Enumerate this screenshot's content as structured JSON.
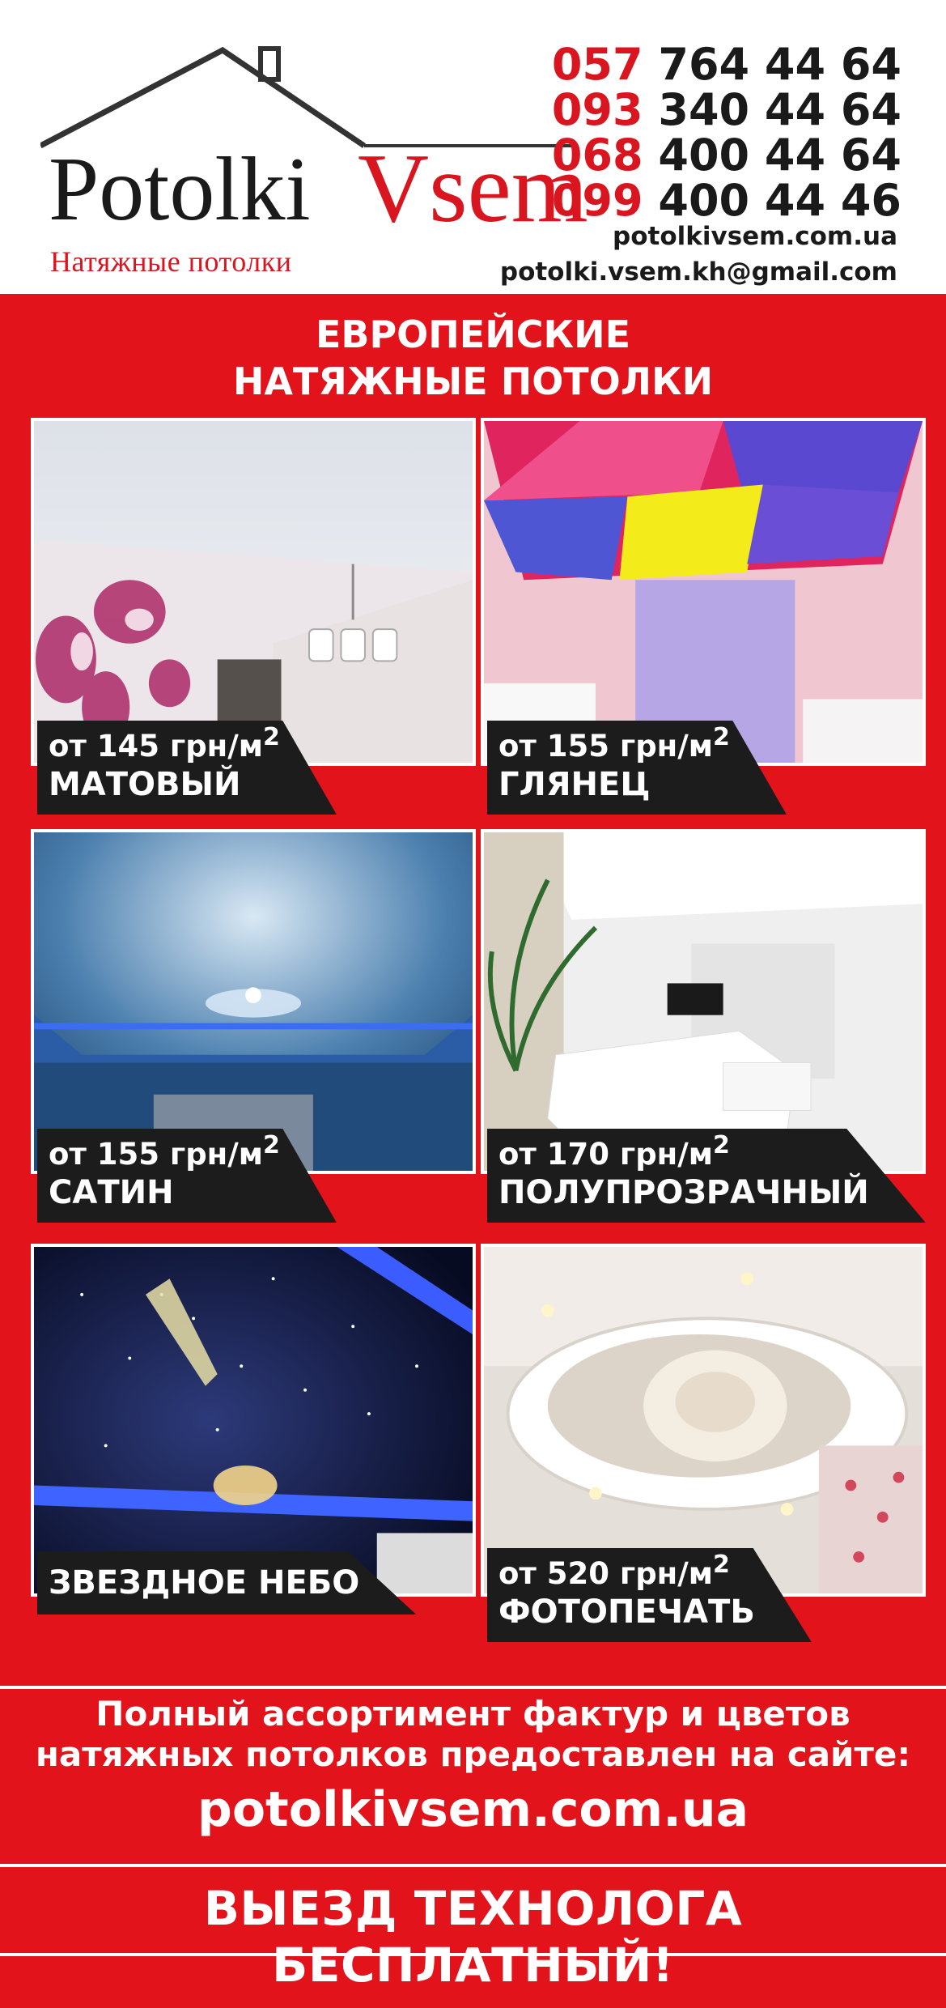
{
  "brand": {
    "name_part1": "Potolki",
    "name_part2": "Vsem",
    "subtitle": "Натяжные потолки"
  },
  "contacts": {
    "phones": [
      {
        "code": "057",
        "number": "764 44 64"
      },
      {
        "code": "093",
        "number": "340 44 64"
      },
      {
        "code": "068",
        "number": "400 44 64"
      },
      {
        "code": "099",
        "number": "400 44 46"
      }
    ],
    "website": "potolkivsem.com.ua",
    "email": "potolki.vsem.kh@gmail.com"
  },
  "headline": {
    "line1": "ЕВРОПЕЙСКИЕ",
    "line2": "НАТЯЖНЫЕ ПОТОЛКИ"
  },
  "products": [
    {
      "price": "от 145 грн/м",
      "unit_exp": "2",
      "name": "МАТОВЫЙ"
    },
    {
      "price": "от 155 грн/м",
      "unit_exp": "2",
      "name": "ГЛЯНЕЦ"
    },
    {
      "price": "от 155 грн/м",
      "unit_exp": "2",
      "name": "САТИН"
    },
    {
      "price": "от 170 грн/м",
      "unit_exp": "2",
      "name": "ПОЛУПРОЗРАЧНЫЙ"
    },
    {
      "name": "ЗВЕЗДНОЕ НЕБО"
    },
    {
      "price": "от 520 грн/м",
      "unit_exp": "2",
      "name": "ФОТОПЕЧАТЬ"
    }
  ],
  "assortment": {
    "line1": "Полный ассортимент фактур и цветов",
    "line2": "натяжных потолков предоставлен на сайте:",
    "website": "potolkivsem.com.ua"
  },
  "promo": "ВЫЕЗД ТЕХНОЛОГА БЕСПЛАТНЫЙ!",
  "colors": {
    "brand_red": "#e3131b",
    "dark_label": "#1c1c1c",
    "text_dark": "#1a1a1a"
  }
}
